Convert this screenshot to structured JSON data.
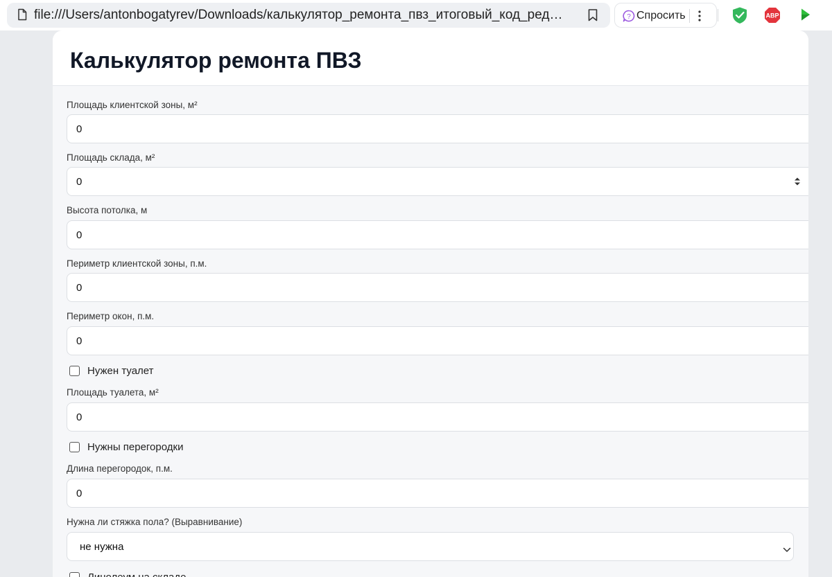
{
  "browser": {
    "url": "file:///Users/antonbogatyrev/Downloads/калькулятор_ремонта_пвз_итоговый_код_редактир...",
    "ask_label": "Спросить",
    "abp_label": "ABP",
    "icons": [
      "page-icon",
      "bookmark-icon",
      "ask-icon",
      "kebab-icon",
      "shield-icon",
      "abp-icon",
      "play-icon"
    ]
  },
  "page": {
    "title": "Калькулятор ремонта ПВЗ"
  },
  "form": {
    "client_area": {
      "label": "Площадь клиентской зоны, м²",
      "value": "0"
    },
    "warehouse_area": {
      "label": "Площадь склада, м²",
      "value": "0"
    },
    "ceiling_height": {
      "label": "Высота потолка, м",
      "value": "0"
    },
    "client_perimeter": {
      "label": "Периметр клиентской зоны, п.м.",
      "value": "0"
    },
    "window_perimeter": {
      "label": "Периметр окон, п.м.",
      "value": "0"
    },
    "need_toilet": {
      "label": "Нужен туалет",
      "checked": false
    },
    "toilet_area": {
      "label": "Площадь туалета, м²",
      "value": "0"
    },
    "need_partitions": {
      "label": "Нужны перегородки",
      "checked": false
    },
    "partitions_length": {
      "label": "Длина перегородок, п.м.",
      "value": "0"
    },
    "floor_screed": {
      "label": "Нужна ли стяжка пола? (Выравнивание)",
      "selected": "не нужна"
    },
    "warehouse_linoleum": {
      "label": "Линолеум на складе",
      "checked": false
    }
  },
  "colors": {
    "title": "#111827",
    "shield_green": "#34b85c",
    "abp_red": "#e3343c",
    "play_green": "#2fbf3c",
    "ask_purple": "#9b59e0"
  }
}
